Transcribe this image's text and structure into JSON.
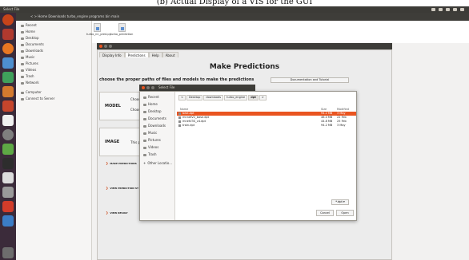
{
  "caption": "(b) Actual Display of a VIS for the GUI",
  "topbar": {
    "title": "Select File"
  },
  "files_window": {
    "breadcrumb": "< >  Home  Downloads  turbo_engine  programs  bin  main",
    "sidebar": [
      "Recent",
      "Home",
      "Desktop",
      "Documents",
      "Downloads",
      "Music",
      "Pictures",
      "Videos",
      "Trash",
      "Network",
      "Computer",
      "Connect to Server"
    ],
    "desktop_files": [
      {
        "name": "turbo_nn_pred.py"
      },
      {
        "name": "turbo_prediction"
      }
    ]
  },
  "app": {
    "tabs": [
      "Display Info",
      "Predictions",
      "Help",
      "About"
    ],
    "active_tab": "Predictions",
    "title": "Make Predictions",
    "subtitle": "choose the proper paths of files and models to make the predictions",
    "doc_button": "Documentation and Tutorial",
    "sections": [
      {
        "label": "MODEL",
        "line1": "Choos",
        "line2": "Choos"
      },
      {
        "label": "IMAGE",
        "line1": "This pi"
      }
    ],
    "actions": [
      "MAKE PREDICTIONS",
      "VIEW PREDICTION ST",
      "VIEW RESULT"
    ]
  },
  "dialog": {
    "title": "Select File",
    "sidebar": [
      "Recent",
      "Home",
      "Desktop",
      "Documents",
      "Downloads",
      "Music",
      "Pictures",
      "Videos",
      "Trash",
      "Other Locatio..."
    ],
    "path": [
      "<",
      "Desktop",
      "downloads",
      "turbo_engine",
      "dpt",
      ">"
    ],
    "columns": {
      "name": "Name",
      "size": "Size",
      "modified": "Modified"
    },
    "files": [
      {
        "name": "best.dpt",
        "size": "94.2 MB",
        "modified": "3 May",
        "selected": true
      },
      {
        "name": "mnnetV2_base.dpt",
        "size": "46.0 MB",
        "modified": "22 Feb",
        "selected": false
      },
      {
        "name": "mnetV3S_v4.dpt",
        "size": "44.8 MB",
        "modified": "25 Feb",
        "selected": false
      },
      {
        "name": "train.dpt",
        "size": "94.2 MB",
        "modified": "3 May",
        "selected": false
      }
    ],
    "filter": "*.dpt",
    "cancel": "Cancel",
    "open": "Open"
  },
  "colors": {
    "accent": "#e95420",
    "titlebar": "#3e3d39",
    "launcher": "#3b2b3a"
  }
}
